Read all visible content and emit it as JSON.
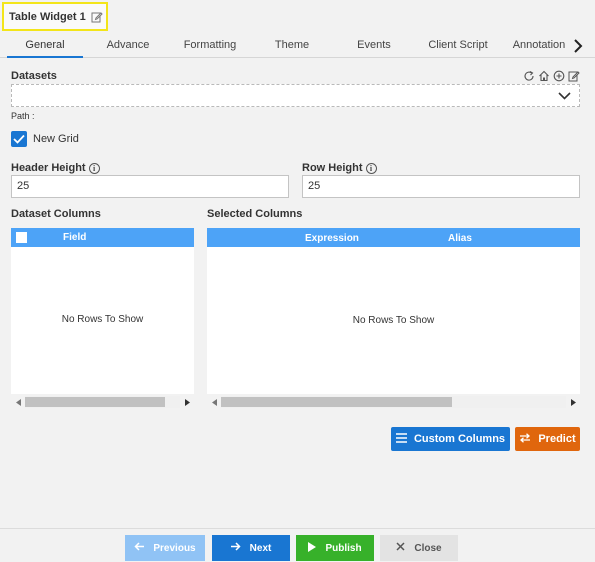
{
  "widget": {
    "title": "Table Widget 1"
  },
  "tabs": [
    {
      "label": "General",
      "active": true
    },
    {
      "label": "Advance"
    },
    {
      "label": "Formatting"
    },
    {
      "label": "Theme"
    },
    {
      "label": "Events"
    },
    {
      "label": "Client Script"
    },
    {
      "label": "Annotation"
    }
  ],
  "datasets": {
    "label": "Datasets",
    "value": "",
    "path_label": "Path :"
  },
  "new_grid": {
    "label": "New Grid",
    "checked": true
  },
  "header_height": {
    "label": "Header Height",
    "value": "25"
  },
  "row_height": {
    "label": "Row Height",
    "value": "25"
  },
  "dataset_columns": {
    "label": "Dataset Columns",
    "header_field": "Field",
    "empty_text": "No Rows To Show"
  },
  "selected_columns": {
    "label": "Selected Columns",
    "header_expression": "Expression",
    "header_alias": "Alias",
    "empty_text": "No Rows To Show"
  },
  "actions": {
    "custom_columns": "Custom Columns",
    "predict": "Predict"
  },
  "footer": {
    "previous": "Previous",
    "next": "Next",
    "publish": "Publish",
    "close": "Close"
  },
  "colors": {
    "accent": "#1976d2",
    "grid_header": "#4da3f7",
    "predict": "#e0660d",
    "publish": "#37b12a",
    "previous_disabled": "#90c3f5",
    "close_bg": "#e3e3e3",
    "highlight": "#f3e51a"
  }
}
